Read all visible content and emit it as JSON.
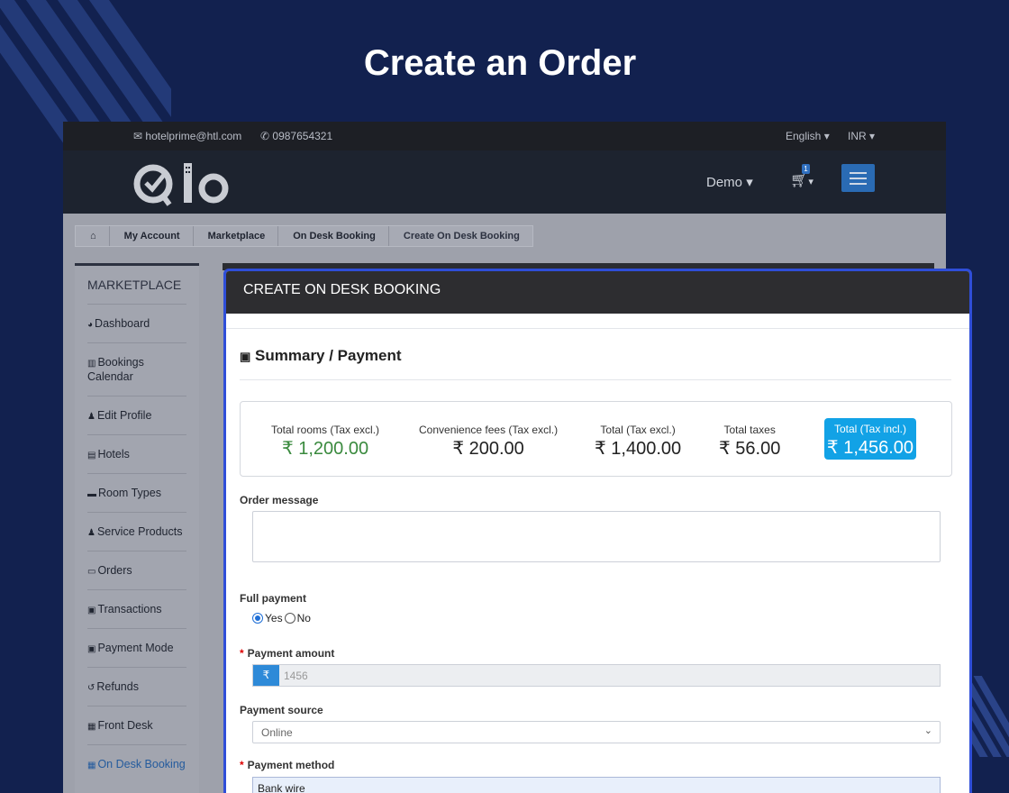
{
  "headline": "Create an Order",
  "topbar": {
    "email": "hotelprime@htl.com",
    "phone": "0987654321",
    "language": "English",
    "currency": "INR"
  },
  "navbar": {
    "user": "Demo",
    "cart_count": "1"
  },
  "breadcrumb": [
    "My Account",
    "Marketplace",
    "On Desk Booking",
    "Create On Desk Booking"
  ],
  "sidebar": {
    "title": "MARKETPLACE",
    "items": [
      {
        "label": "Dashboard",
        "icon": "dashboard-icon",
        "glyph": "◕"
      },
      {
        "label": "Bookings Calendar",
        "icon": "bar-chart-icon",
        "glyph": "▥"
      },
      {
        "label": "Edit Profile",
        "icon": "user-icon",
        "glyph": "♟"
      },
      {
        "label": "Hotels",
        "icon": "building-icon",
        "glyph": "▤"
      },
      {
        "label": "Room Types",
        "icon": "bed-icon",
        "glyph": "▬"
      },
      {
        "label": "Service Products",
        "icon": "user-plus-icon",
        "glyph": "♟"
      },
      {
        "label": "Orders",
        "icon": "credit-card-icon",
        "glyph": "▭"
      },
      {
        "label": "Transactions",
        "icon": "money-icon",
        "glyph": "▣"
      },
      {
        "label": "Payment Mode",
        "icon": "money-icon",
        "glyph": "▣"
      },
      {
        "label": "Refunds",
        "icon": "undo-icon",
        "glyph": "↺"
      },
      {
        "label": "Front Desk",
        "icon": "calendar-icon",
        "glyph": "▦"
      },
      {
        "label": "On Desk Booking",
        "icon": "calendar-icon",
        "glyph": "▦"
      }
    ]
  },
  "card": {
    "title": "CREATE ON DESK BOOKING",
    "section_title": "Summary / Payment",
    "summary": [
      {
        "label": "Total rooms (Tax excl.)",
        "value": "₹ 1,200.00"
      },
      {
        "label": "Convenience fees (Tax excl.)",
        "value": "₹ 200.00"
      },
      {
        "label": "Total (Tax excl.)",
        "value": "₹ 1,400.00"
      },
      {
        "label": "Total taxes",
        "value": "₹ 56.00"
      },
      {
        "label": "Total (Tax incl.)",
        "value": "₹ 1,456.00"
      }
    ],
    "order_message_label": "Order message",
    "full_payment_label": "Full payment",
    "yes_label": "Yes",
    "no_label": "No",
    "payment_amount_label": "Payment amount",
    "currency_symbol": "₹",
    "payment_amount_value": "1456",
    "payment_source_label": "Payment source",
    "payment_source_value": "Online",
    "payment_method_label": "Payment method",
    "payment_method_value": "Bank wire"
  },
  "colors": {
    "background": "#12214f",
    "highlight_border": "#2f4ed8",
    "total_badge": "#12a2e6",
    "green_value": "#3a8a3e"
  }
}
